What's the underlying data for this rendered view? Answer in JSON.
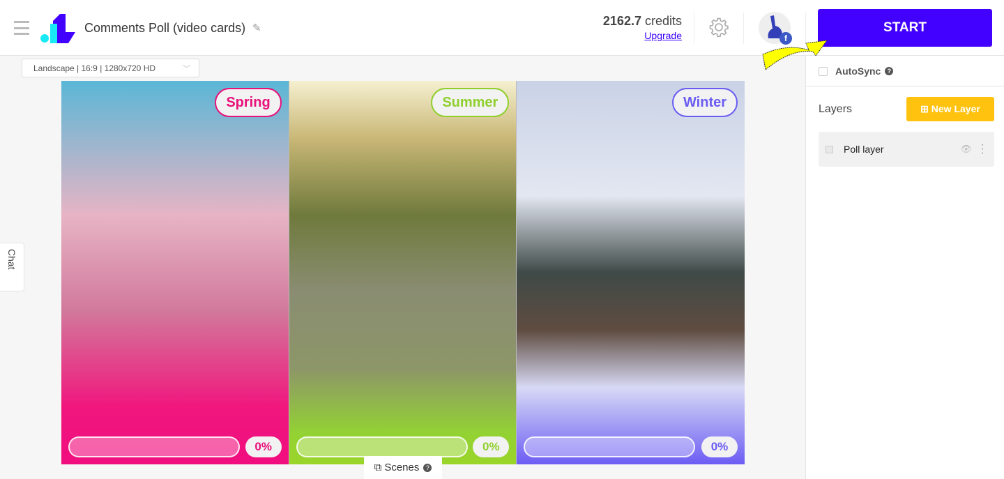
{
  "header": {
    "title": "Comments Poll (video cards)",
    "credits_value": "2162.7",
    "credits_unit": "credits",
    "upgrade": "Upgrade",
    "start": "START"
  },
  "format": {
    "selected": "Landscape | 16:9 | 1280x720 HD"
  },
  "sidebar": {
    "autosync": "AutoSync",
    "help": "?",
    "layers_label": "Layers",
    "new_layer": "New Layer",
    "layers": [
      {
        "name": "Poll layer"
      }
    ]
  },
  "poll": {
    "options": [
      {
        "label": "Spring",
        "percent": "0%",
        "color": "#e8107a"
      },
      {
        "label": "Summer",
        "percent": "0%",
        "color": "#8fcf2c"
      },
      {
        "label": "Winter",
        "percent": "0%",
        "color": "#6a5cf2"
      }
    ]
  },
  "chat": "Chat",
  "scenes": "Scenes",
  "colors": {
    "accent": "#4200ff",
    "new_layer": "#ffc20e"
  }
}
